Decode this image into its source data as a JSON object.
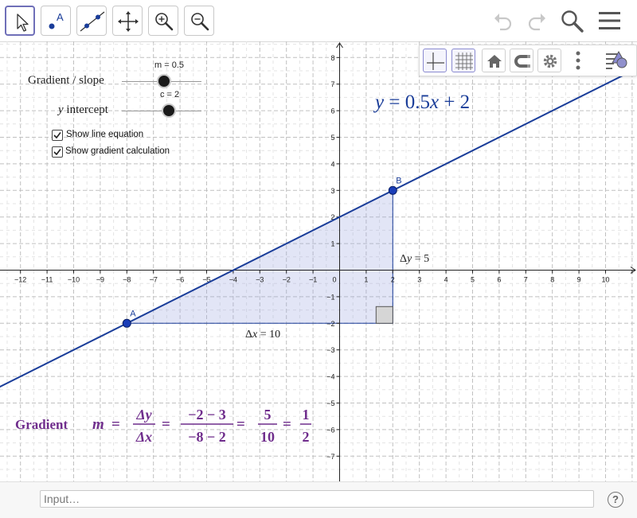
{
  "toolbar": {
    "tools": [
      {
        "icon": "arrow-pointer-icon",
        "active": true
      },
      {
        "icon": "point-icon"
      },
      {
        "icon": "line-through-two-points-icon"
      },
      {
        "icon": "move-graphics-view-icon"
      },
      {
        "icon": "zoom-in-icon"
      },
      {
        "icon": "zoom-out-icon"
      }
    ],
    "point_letter": "A",
    "right_icons": [
      "undo-icon",
      "redo-icon",
      "search-icon",
      "menu-icon"
    ]
  },
  "style_bar": {
    "buttons": [
      "axes-icon",
      "grid-icon",
      "home-icon",
      "magnet-icon",
      "gear-icon",
      "more-icon",
      "toggle-style-bar-icon"
    ]
  },
  "sliders": {
    "gradient": {
      "label": "Gradient / slope",
      "value_text": "m = 0.5",
      "value": 0.5
    },
    "intercept": {
      "label_italic": "y",
      "label_rest": " intercept",
      "value_text": "c = 2",
      "value": 2
    }
  },
  "checkboxes": [
    {
      "label": "Show line equation",
      "checked": true
    },
    {
      "label": "Show gradient calculation",
      "checked": true
    }
  ],
  "graph": {
    "x_ticks": [
      "−12",
      "−11",
      "−10",
      "−9",
      "−8",
      "−7",
      "−6",
      "−5",
      "−4",
      "−3",
      "−2",
      "−1",
      "0",
      "1",
      "2",
      "3",
      "4",
      "5",
      "6",
      "7",
      "8",
      "9",
      "10"
    ],
    "y_ticks": [
      "8",
      "7",
      "6",
      "5",
      "4",
      "3",
      "2",
      "1",
      "−1",
      "−2",
      "−3",
      "−4",
      "−5",
      "−6",
      "−7"
    ],
    "equation": {
      "lhs": "y",
      "eq": " = 0.5",
      "x": "x",
      "rest": " + 2"
    },
    "line": {
      "m": 0.5,
      "c": 2,
      "color": "#1a3d99"
    },
    "points": [
      {
        "label": "A",
        "x": -8,
        "y": -2
      },
      {
        "label": "B",
        "x": 2,
        "y": 3
      }
    ],
    "delta_x": {
      "delta": "Δ",
      "var": "x",
      "rest": " = 10"
    },
    "delta_y": {
      "delta": "Δ",
      "var": "y",
      "rest": " = 5"
    },
    "gradient_calc": {
      "label": "Gradient",
      "m": "m",
      "equals": "=",
      "frac1_num": "Δy",
      "frac1_den": "Δx",
      "frac2_num": "−2 − 3",
      "frac2_den": "−8 − 2",
      "frac3_num": "5",
      "frac3_den": "10",
      "frac4_num": "1",
      "frac4_den": "2",
      "color": "#6f2d8c"
    }
  },
  "footer": {
    "input_placeholder": "Input…",
    "help_label": "?"
  }
}
